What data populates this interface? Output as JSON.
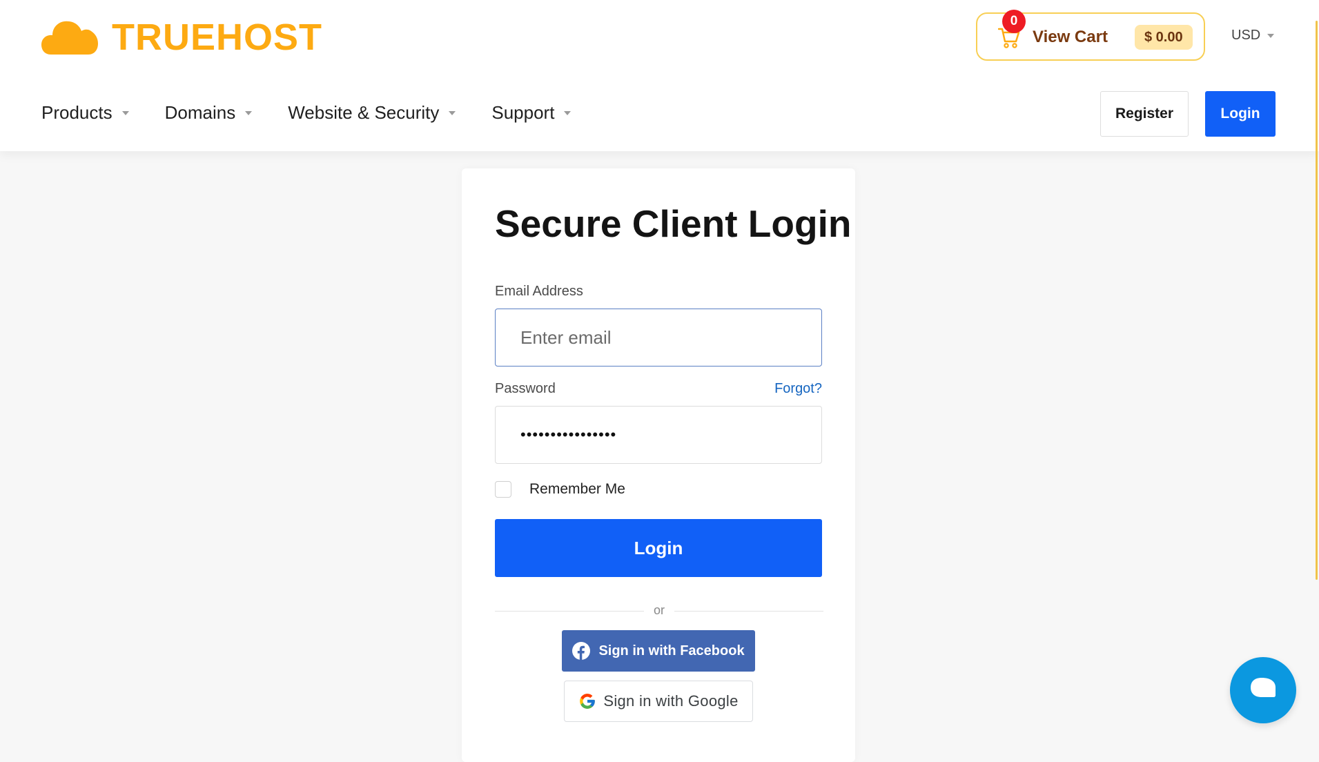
{
  "header": {
    "brand": "TRUEHOST",
    "cart": {
      "badge_count": "0",
      "label": "View Cart",
      "amount": "$ 0.00"
    },
    "currency": "USD",
    "nav": [
      {
        "label": "Products"
      },
      {
        "label": "Domains"
      },
      {
        "label": "Website & Security"
      },
      {
        "label": "Support"
      }
    ],
    "register_label": "Register",
    "login_label": "Login"
  },
  "login_form": {
    "title": "Secure Client Login",
    "email_label": "Email Address",
    "email_placeholder": "Enter email",
    "password_label": "Password",
    "forgot_label": "Forgot?",
    "password_value": "••••••••••••••••",
    "remember_label": "Remember Me",
    "remember_checked": false,
    "submit_label": "Login",
    "divider_text": "or",
    "facebook_label": "Sign in with Facebook",
    "google_label": "Sign in with Google"
  },
  "icons": {
    "logo": "cloud-icon",
    "cart": "shopping-cart-icon",
    "facebook": "facebook-icon",
    "google": "google-icon",
    "chat": "chat-bubble-icon"
  },
  "colors": {
    "brand_orange": "#fdaa12",
    "primary_blue": "#1160f7",
    "facebook_blue": "#4267b2",
    "chat_blue": "#0b98e0",
    "badge_red": "#ee1c24"
  }
}
